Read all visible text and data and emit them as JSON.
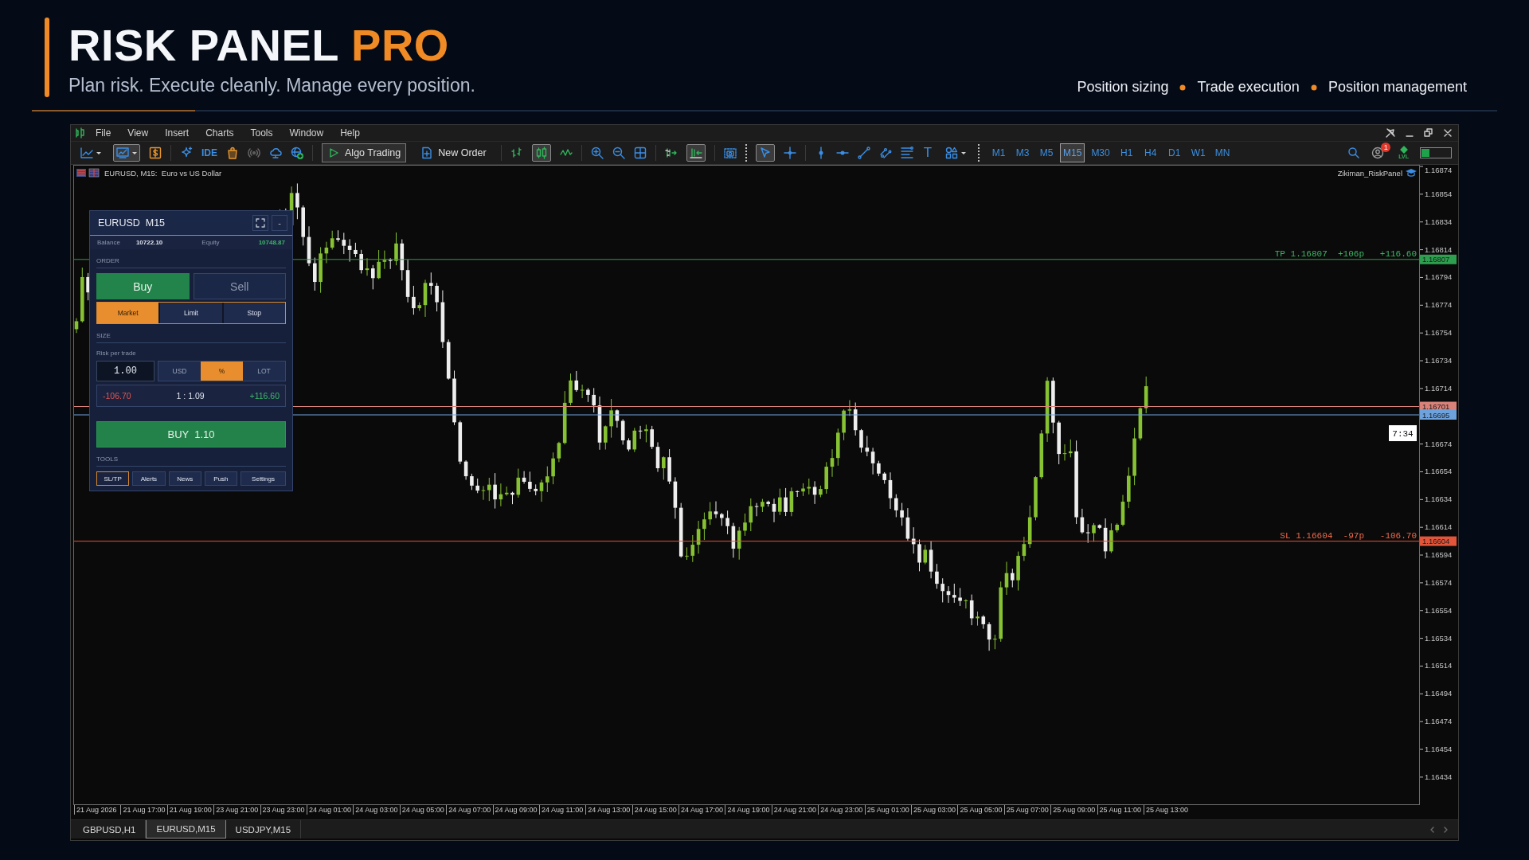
{
  "header": {
    "title": "RISK PANEL",
    "title_accent": "PRO",
    "tagline": "Plan risk. Execute cleanly. Manage every position.",
    "features": [
      "Position sizing",
      "Trade execution",
      "Position management"
    ]
  },
  "menu": [
    "File",
    "View",
    "Insert",
    "Charts",
    "Tools",
    "Window",
    "Help"
  ],
  "toolbar": {
    "ide": "IDE",
    "algo_trading": "Algo Trading",
    "new_order": "New Order",
    "text_tool": "T",
    "toggles": {
      "chart_window": true,
      "candlesticks": true,
      "auto_scroll": true,
      "cursor": true
    },
    "timeframes": [
      {
        "label": "M1",
        "selected": false
      },
      {
        "label": "M3",
        "selected": false
      },
      {
        "label": "M5",
        "selected": false
      },
      {
        "label": "M15",
        "selected": true
      },
      {
        "label": "M30",
        "selected": false
      },
      {
        "label": "H1",
        "selected": false
      },
      {
        "label": "H4",
        "selected": false
      },
      {
        "label": "D1",
        "selected": false
      },
      {
        "label": "W1",
        "selected": false
      },
      {
        "label": "MN",
        "selected": false
      }
    ],
    "notification_count": "1",
    "lvl": "LVL"
  },
  "chart": {
    "symbol_title": "EURUSD, M15:  Euro vs US Dollar",
    "indicator": "Zikiman_RiskPanel",
    "price_ticks": [
      "1.16874",
      "1.16854",
      "1.16834",
      "1.16814",
      "1.16794",
      "1.16774",
      "1.16754",
      "1.16734",
      "1.16714",
      "1.16674",
      "1.16654",
      "1.16634",
      "1.16614",
      "1.16594",
      "1.16574",
      "1.16554",
      "1.16534",
      "1.16514",
      "1.16494",
      "1.16474",
      "1.16454",
      "1.16434"
    ],
    "price_lines": [
      {
        "kind": "tp",
        "label": "TP 1.16807  +106p   +116.60",
        "tag": "1.16807",
        "color": "#2e9e4f"
      },
      {
        "kind": "plain",
        "tag": "1.16701",
        "color": "#d9827a"
      },
      {
        "kind": "plain",
        "tag": "1.16695",
        "color": "#6ea2dd"
      },
      {
        "kind": "sl",
        "label": "SL 1.16604  -97p   -106.70",
        "tag": "1.16604",
        "color": "#e2553a"
      }
    ],
    "countdown": "7:34",
    "time_labels": [
      "21 Aug 2026",
      "21 Aug 17:00",
      "21 Aug 19:00",
      "23 Aug 21:00",
      "23 Aug 23:00",
      "24 Aug 01:00",
      "24 Aug 03:00",
      "24 Aug 05:00",
      "24 Aug 07:00",
      "24 Aug 09:00",
      "24 Aug 11:00",
      "24 Aug 13:00",
      "24 Aug 15:00",
      "24 Aug 17:00",
      "24 Aug 19:00",
      "24 Aug 21:00",
      "24 Aug 23:00",
      "25 Aug 01:00",
      "25 Aug 03:00",
      "25 Aug 05:00",
      "25 Aug 07:00",
      "25 Aug 09:00",
      "25 Aug 11:00",
      "25 Aug 13:00"
    ]
  },
  "panel": {
    "title": "EURUSD  M15",
    "minimize": "-",
    "balance_label": "Balance",
    "balance": "10722.10",
    "equity_label": "Equity",
    "equity": "10748.87",
    "order_heading": "ORDER",
    "sides": [
      {
        "label": "Buy",
        "selected": true
      },
      {
        "label": "Sell",
        "selected": false
      }
    ],
    "order_types": [
      {
        "label": "Market",
        "selected": true
      },
      {
        "label": "Limit",
        "selected": false
      },
      {
        "label": "Stop",
        "selected": false
      }
    ],
    "size_heading": "SIZE",
    "risk_label": "Risk per trade",
    "risk_value": "1.00",
    "units": [
      {
        "label": "USD",
        "selected": false
      },
      {
        "label": "%",
        "selected": true
      },
      {
        "label": "LOT",
        "selected": false
      }
    ],
    "loss": "-106.70",
    "ratio": "1 : 1.09",
    "profit": "+116.60",
    "action": "BUY  1.10",
    "tools_heading": "TOOLS",
    "tools": [
      {
        "label": "SL/TP",
        "selected": true
      },
      {
        "label": "Alerts",
        "selected": false
      },
      {
        "label": "News",
        "selected": false
      },
      {
        "label": "Push",
        "selected": false
      },
      {
        "label": "Settings",
        "selected": false
      }
    ]
  },
  "tabs": [
    {
      "label": "GBPUSD,H1",
      "selected": false
    },
    {
      "label": "EURUSD,M15",
      "selected": true
    },
    {
      "label": "USDJPY,M15",
      "selected": false
    }
  ]
}
